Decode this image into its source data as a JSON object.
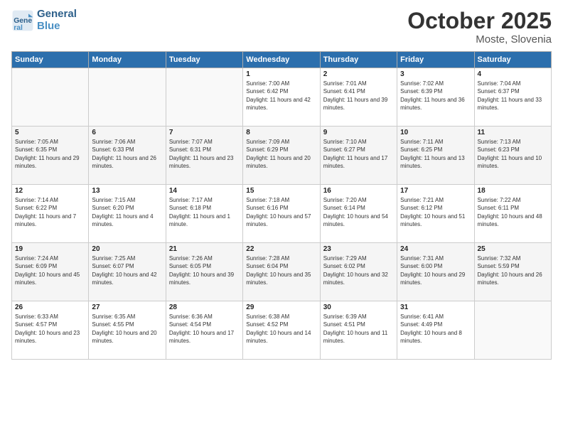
{
  "header": {
    "logo_general": "General",
    "logo_blue": "Blue",
    "month_title": "October 2025",
    "location": "Moste, Slovenia"
  },
  "weekdays": [
    "Sunday",
    "Monday",
    "Tuesday",
    "Wednesday",
    "Thursday",
    "Friday",
    "Saturday"
  ],
  "weeks": [
    [
      {
        "day": "",
        "sunrise": "",
        "sunset": "",
        "daylight": ""
      },
      {
        "day": "",
        "sunrise": "",
        "sunset": "",
        "daylight": ""
      },
      {
        "day": "",
        "sunrise": "",
        "sunset": "",
        "daylight": ""
      },
      {
        "day": "1",
        "sunrise": "Sunrise: 7:00 AM",
        "sunset": "Sunset: 6:42 PM",
        "daylight": "Daylight: 11 hours and 42 minutes."
      },
      {
        "day": "2",
        "sunrise": "Sunrise: 7:01 AM",
        "sunset": "Sunset: 6:41 PM",
        "daylight": "Daylight: 11 hours and 39 minutes."
      },
      {
        "day": "3",
        "sunrise": "Sunrise: 7:02 AM",
        "sunset": "Sunset: 6:39 PM",
        "daylight": "Daylight: 11 hours and 36 minutes."
      },
      {
        "day": "4",
        "sunrise": "Sunrise: 7:04 AM",
        "sunset": "Sunset: 6:37 PM",
        "daylight": "Daylight: 11 hours and 33 minutes."
      }
    ],
    [
      {
        "day": "5",
        "sunrise": "Sunrise: 7:05 AM",
        "sunset": "Sunset: 6:35 PM",
        "daylight": "Daylight: 11 hours and 29 minutes."
      },
      {
        "day": "6",
        "sunrise": "Sunrise: 7:06 AM",
        "sunset": "Sunset: 6:33 PM",
        "daylight": "Daylight: 11 hours and 26 minutes."
      },
      {
        "day": "7",
        "sunrise": "Sunrise: 7:07 AM",
        "sunset": "Sunset: 6:31 PM",
        "daylight": "Daylight: 11 hours and 23 minutes."
      },
      {
        "day": "8",
        "sunrise": "Sunrise: 7:09 AM",
        "sunset": "Sunset: 6:29 PM",
        "daylight": "Daylight: 11 hours and 20 minutes."
      },
      {
        "day": "9",
        "sunrise": "Sunrise: 7:10 AM",
        "sunset": "Sunset: 6:27 PM",
        "daylight": "Daylight: 11 hours and 17 minutes."
      },
      {
        "day": "10",
        "sunrise": "Sunrise: 7:11 AM",
        "sunset": "Sunset: 6:25 PM",
        "daylight": "Daylight: 11 hours and 13 minutes."
      },
      {
        "day": "11",
        "sunrise": "Sunrise: 7:13 AM",
        "sunset": "Sunset: 6:23 PM",
        "daylight": "Daylight: 11 hours and 10 minutes."
      }
    ],
    [
      {
        "day": "12",
        "sunrise": "Sunrise: 7:14 AM",
        "sunset": "Sunset: 6:22 PM",
        "daylight": "Daylight: 11 hours and 7 minutes."
      },
      {
        "day": "13",
        "sunrise": "Sunrise: 7:15 AM",
        "sunset": "Sunset: 6:20 PM",
        "daylight": "Daylight: 11 hours and 4 minutes."
      },
      {
        "day": "14",
        "sunrise": "Sunrise: 7:17 AM",
        "sunset": "Sunset: 6:18 PM",
        "daylight": "Daylight: 11 hours and 1 minute."
      },
      {
        "day": "15",
        "sunrise": "Sunrise: 7:18 AM",
        "sunset": "Sunset: 6:16 PM",
        "daylight": "Daylight: 10 hours and 57 minutes."
      },
      {
        "day": "16",
        "sunrise": "Sunrise: 7:20 AM",
        "sunset": "Sunset: 6:14 PM",
        "daylight": "Daylight: 10 hours and 54 minutes."
      },
      {
        "day": "17",
        "sunrise": "Sunrise: 7:21 AM",
        "sunset": "Sunset: 6:12 PM",
        "daylight": "Daylight: 10 hours and 51 minutes."
      },
      {
        "day": "18",
        "sunrise": "Sunrise: 7:22 AM",
        "sunset": "Sunset: 6:11 PM",
        "daylight": "Daylight: 10 hours and 48 minutes."
      }
    ],
    [
      {
        "day": "19",
        "sunrise": "Sunrise: 7:24 AM",
        "sunset": "Sunset: 6:09 PM",
        "daylight": "Daylight: 10 hours and 45 minutes."
      },
      {
        "day": "20",
        "sunrise": "Sunrise: 7:25 AM",
        "sunset": "Sunset: 6:07 PM",
        "daylight": "Daylight: 10 hours and 42 minutes."
      },
      {
        "day": "21",
        "sunrise": "Sunrise: 7:26 AM",
        "sunset": "Sunset: 6:05 PM",
        "daylight": "Daylight: 10 hours and 39 minutes."
      },
      {
        "day": "22",
        "sunrise": "Sunrise: 7:28 AM",
        "sunset": "Sunset: 6:04 PM",
        "daylight": "Daylight: 10 hours and 35 minutes."
      },
      {
        "day": "23",
        "sunrise": "Sunrise: 7:29 AM",
        "sunset": "Sunset: 6:02 PM",
        "daylight": "Daylight: 10 hours and 32 minutes."
      },
      {
        "day": "24",
        "sunrise": "Sunrise: 7:31 AM",
        "sunset": "Sunset: 6:00 PM",
        "daylight": "Daylight: 10 hours and 29 minutes."
      },
      {
        "day": "25",
        "sunrise": "Sunrise: 7:32 AM",
        "sunset": "Sunset: 5:59 PM",
        "daylight": "Daylight: 10 hours and 26 minutes."
      }
    ],
    [
      {
        "day": "26",
        "sunrise": "Sunrise: 6:33 AM",
        "sunset": "Sunset: 4:57 PM",
        "daylight": "Daylight: 10 hours and 23 minutes."
      },
      {
        "day": "27",
        "sunrise": "Sunrise: 6:35 AM",
        "sunset": "Sunset: 4:55 PM",
        "daylight": "Daylight: 10 hours and 20 minutes."
      },
      {
        "day": "28",
        "sunrise": "Sunrise: 6:36 AM",
        "sunset": "Sunset: 4:54 PM",
        "daylight": "Daylight: 10 hours and 17 minutes."
      },
      {
        "day": "29",
        "sunrise": "Sunrise: 6:38 AM",
        "sunset": "Sunset: 4:52 PM",
        "daylight": "Daylight: 10 hours and 14 minutes."
      },
      {
        "day": "30",
        "sunrise": "Sunrise: 6:39 AM",
        "sunset": "Sunset: 4:51 PM",
        "daylight": "Daylight: 10 hours and 11 minutes."
      },
      {
        "day": "31",
        "sunrise": "Sunrise: 6:41 AM",
        "sunset": "Sunset: 4:49 PM",
        "daylight": "Daylight: 10 hours and 8 minutes."
      },
      {
        "day": "",
        "sunrise": "",
        "sunset": "",
        "daylight": ""
      }
    ]
  ]
}
